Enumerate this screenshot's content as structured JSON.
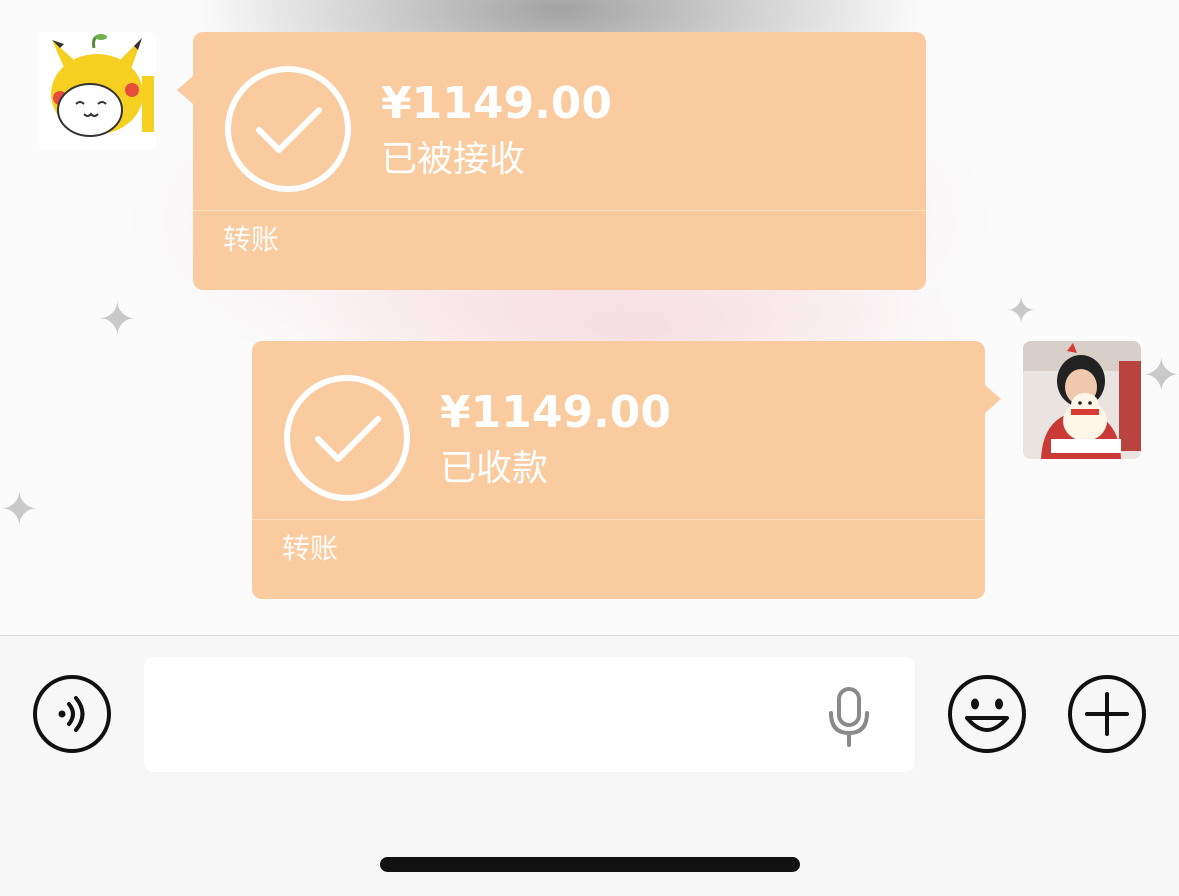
{
  "messages": [
    {
      "amount": "¥1149.00",
      "status": "已被接收",
      "type_label": "转账",
      "sender": "contact"
    },
    {
      "amount": "¥1149.00",
      "status": "已收款",
      "type_label": "转账",
      "sender": "self"
    }
  ],
  "input_bar": {
    "voice_icon": "voice-mode-icon",
    "microphone_icon": "microphone-icon",
    "emoji_icon": "emoji-icon",
    "more_icon": "plus-icon"
  },
  "colors": {
    "bubble": "#f9cb9f",
    "bubble_text": "#ffffff",
    "input_bar_bg": "#f7f7f7",
    "field_bg": "#ffffff"
  }
}
